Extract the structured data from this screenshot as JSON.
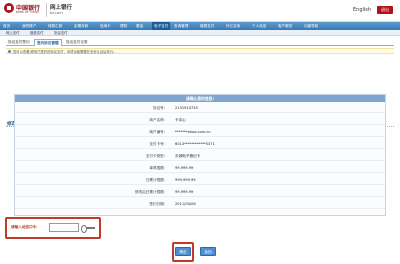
{
  "header": {
    "bank_name": "中国银行",
    "bank_en": "BANK OF CHINA",
    "product_title": "网上银行",
    "product_en": "BOCNET",
    "language": "English",
    "logout_label": "退出"
  },
  "main_nav": [
    "首页",
    "我的账户",
    "转账汇款",
    "定期存款",
    "信用卡",
    "理财",
    "基金",
    "电子支付",
    "查询管理",
    "缴费支付",
    "外汇买卖",
    "个人设定",
    "客户服务",
    "功能导航"
  ],
  "main_nav_active_index": 7,
  "sub_nav": [
    "网上支付",
    "缴费支付",
    "协议支付"
  ],
  "tabs": [
    "协议支付签约",
    "签约协议管理",
    "协议支付记录"
  ],
  "active_tab_index": 1,
  "info_text": "您可以查看/修改已签约的协议支付，本项功能需要在安全认证后执行。",
  "page_heading": "修改协议支付日累计限额",
  "panel": {
    "title": "请确认您的信息!",
    "rows": [
      {
        "label": "协议号:",
        "value": "2151910735"
      },
      {
        "label": "商户名称:",
        "value": "卡中心"
      },
      {
        "label": "商户编号:",
        "value": "*******ahoo.com.cn"
      },
      {
        "label": "支付卡号:",
        "value": "6013************5371"
      },
      {
        "label": "支付卡类型:",
        "value": "长城电子借记卡"
      },
      {
        "label": "单笔限额:",
        "value": "99,999.99"
      },
      {
        "label": "日累计限额:",
        "value": "999,999.99"
      },
      {
        "label": "修改后日累计限额:",
        "value": "99,999.99"
      },
      {
        "label": "签约日期:",
        "value": "2011/04/06"
      }
    ]
  },
  "password": {
    "label": "请输入动态口令:",
    "value": ""
  },
  "buttons": {
    "confirm": "确定",
    "back": "返回"
  },
  "colors": {
    "brand_red": "#b0121b",
    "nav_blue": "#3a78b3",
    "highlight_frame": "#c0392b"
  }
}
